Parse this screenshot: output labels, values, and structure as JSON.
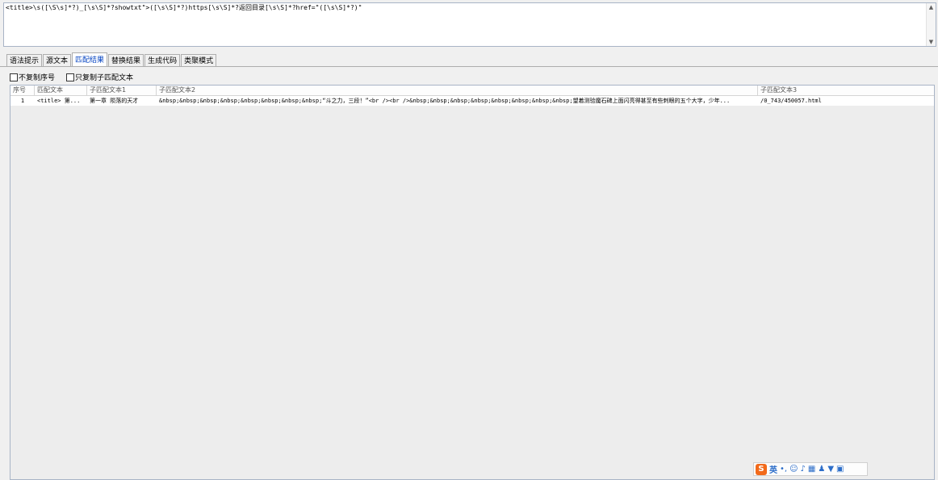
{
  "editor": {
    "pattern": "<title>\\s([\\S\\s]*?)_[\\s\\S]*?showtxt\">([\\s\\S]*?)https[\\s\\S]*?返回目录[\\s\\S]*?href=\"([\\s\\S]*?)\""
  },
  "tabs": [
    "语法提示",
    "源文本",
    "匹配结果",
    "替换结果",
    "生成代码",
    "类聚模式"
  ],
  "options": {
    "no_copy_index": "不复制序号",
    "copy_sub_only": "只复制子匹配文本"
  },
  "grid": {
    "columns": [
      "序号",
      "匹配文本",
      "子匹配文本1",
      "子匹配文本2",
      "子匹配文本3"
    ],
    "rows": [
      {
        "index": "1",
        "match": "<title> 第...",
        "sub1": "第一章 陨落的天才",
        "sub2": "&nbsp;&nbsp;&nbsp;&nbsp;&nbsp;&nbsp;&nbsp;&nbsp;“斗之力，三段！”<br /><br />&nbsp;&nbsp;&nbsp;&nbsp;&nbsp;&nbsp;&nbsp;&nbsp;望着测验魔石碑上面闪亮得甚至有些刺眼的五个大字，少年...",
        "sub3": "/0_743/450057.html"
      }
    ]
  },
  "ime": {
    "logo": "S",
    "lang": "英",
    "icons": [
      "punctuation-icon",
      "emoji-icon",
      "microphone-icon",
      "keyboard-icon",
      "user-icon",
      "skin-icon",
      "toolbox-icon"
    ]
  }
}
